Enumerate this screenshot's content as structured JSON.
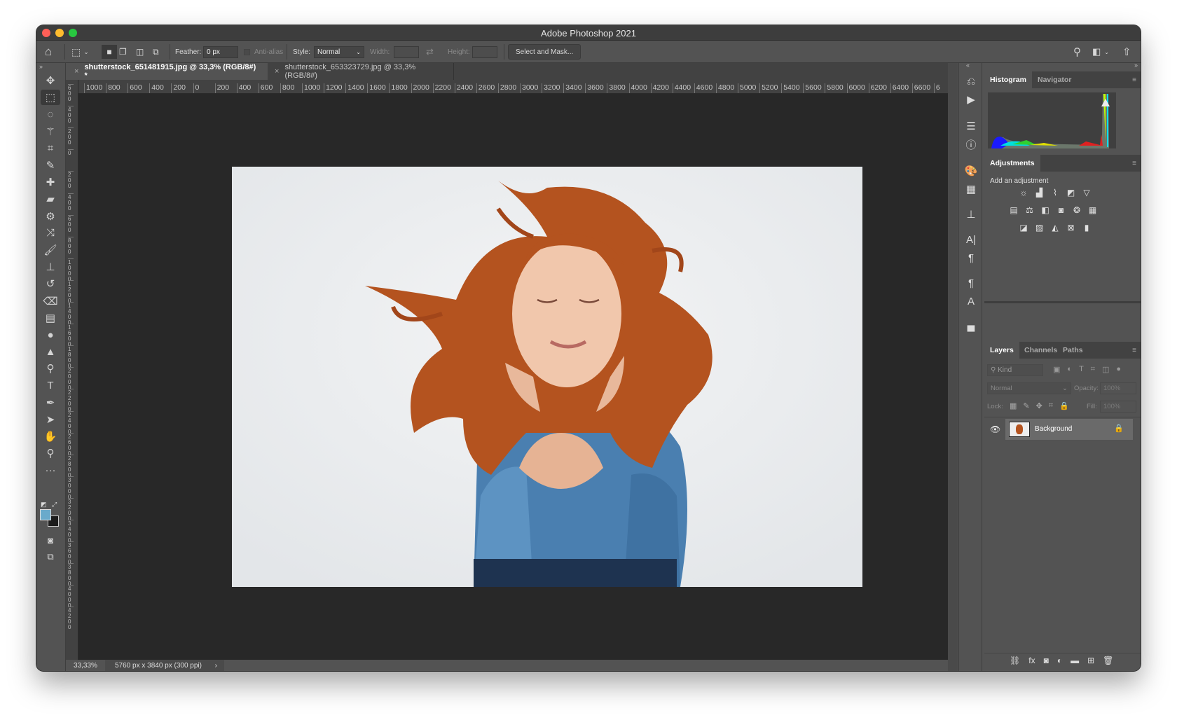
{
  "window": {
    "title": "Adobe Photoshop 2021",
    "traffic_lights": [
      "#fe5f57",
      "#febc2e",
      "#28c840"
    ]
  },
  "options": {
    "feather_label": "Feather:",
    "feather_value": "0 px",
    "antialias_label": "Anti-alias",
    "style_label": "Style:",
    "style_value": "Normal",
    "width_label": "Width:",
    "height_label": "Height:",
    "select_mask": "Select and Mask..."
  },
  "tabs": [
    {
      "label": "shutterstock_651481915.jpg @ 33,3% (RGB/8#) *",
      "active": true
    },
    {
      "label": "shutterstock_653323729.jpg @ 33,3% (RGB/8#)",
      "active": false
    }
  ],
  "hruler": [
    "1000",
    "800",
    "600",
    "400",
    "200",
    "0",
    "200",
    "400",
    "600",
    "800",
    "1000",
    "1200",
    "1400",
    "1600",
    "1800",
    "2000",
    "2200",
    "2400",
    "2600",
    "2800",
    "3000",
    "3200",
    "3400",
    "3600",
    "3800",
    "4000",
    "4200",
    "4400",
    "4600",
    "4800",
    "5000",
    "5200",
    "5400",
    "5600",
    "5800",
    "6000",
    "6200",
    "6400",
    "6600",
    "6"
  ],
  "vruler": [
    "600",
    "400",
    "200",
    "0",
    "200",
    "400",
    "600",
    "800",
    "1000",
    "1200",
    "1400",
    "1600",
    "1800",
    "2000",
    "2200",
    "2400",
    "2600",
    "2800",
    "3000",
    "3200",
    "3400",
    "3600",
    "3800",
    "4000",
    "4200"
  ],
  "tools": [
    {
      "n": "move-tool",
      "g": "✥"
    },
    {
      "n": "rectangular-marquee-tool",
      "g": "⬚"
    },
    {
      "n": "lasso-tool",
      "g": "◌"
    },
    {
      "n": "magic-wand-tool",
      "g": "⚚"
    },
    {
      "n": "crop-tool",
      "g": "⌗"
    },
    {
      "n": "eyedropper-tool",
      "g": "✎"
    },
    {
      "n": "spot-healing-tool",
      "g": "✚"
    },
    {
      "n": "healing-brush-tool",
      "g": "▰"
    },
    {
      "n": "patch-tool",
      "g": "⚙"
    },
    {
      "n": "content-aware-move-tool",
      "g": "⤨"
    },
    {
      "n": "brush-tool",
      "g": "🖌"
    },
    {
      "n": "clone-stamp-tool",
      "g": "⊥"
    },
    {
      "n": "history-brush-tool",
      "g": "↺"
    },
    {
      "n": "eraser-tool",
      "g": "⌫"
    },
    {
      "n": "gradient-tool",
      "g": "▤"
    },
    {
      "n": "blur-tool",
      "g": "●"
    },
    {
      "n": "sharpen-tool",
      "g": "▲"
    },
    {
      "n": "dodge-tool",
      "g": "⚲"
    },
    {
      "n": "type-tool",
      "g": "T"
    },
    {
      "n": "pen-tool",
      "g": "✒"
    },
    {
      "n": "path-selection-tool",
      "g": "➤"
    },
    {
      "n": "hand-tool",
      "g": "✋"
    },
    {
      "n": "zoom-tool",
      "g": "⚲"
    },
    {
      "n": "edit-toolbar",
      "g": "···"
    }
  ],
  "colors": {
    "foreground": "#6aaacb",
    "background": "#1c1c1c",
    "canvas": "#282828",
    "panel": "#535353"
  },
  "status": {
    "zoom": "33,33%",
    "doc_info": "5760 px x 3840 px (300 ppi)"
  },
  "strip": [
    {
      "n": "history-icon",
      "g": "⎌"
    },
    {
      "n": "actions-play-icon",
      "g": "▶"
    },
    {
      "n": "properties-icon",
      "g": "☰"
    },
    {
      "n": "info-icon",
      "g": "ⓘ"
    },
    {
      "n": "swatches-icon",
      "g": "🎨"
    },
    {
      "n": "table-icon",
      "g": "▦"
    },
    {
      "n": "clone-source-icon",
      "g": "⊥"
    },
    {
      "n": "character-icon",
      "g": "A|"
    },
    {
      "n": "paragraph-icon",
      "g": "¶"
    },
    {
      "n": "paragraph-styles-icon",
      "g": "¶"
    },
    {
      "n": "character-styles-icon",
      "g": "A"
    },
    {
      "n": "libraries-icon",
      "g": "▄"
    }
  ],
  "histogram": {
    "tabs": [
      "Histogram",
      "Navigator"
    ]
  },
  "adjustments": {
    "title": "Adjustments",
    "subtitle": "Add an adjustment",
    "rows": [
      [
        {
          "n": "brightness-contrast-icon",
          "g": "☼"
        },
        {
          "n": "levels-icon",
          "g": "▟"
        },
        {
          "n": "curves-icon",
          "g": "⌇"
        },
        {
          "n": "exposure-icon",
          "g": "◩"
        },
        {
          "n": "vibrance-icon",
          "g": "▽"
        }
      ],
      [
        {
          "n": "hue-saturation-icon",
          "g": "▤"
        },
        {
          "n": "color-balance-icon",
          "g": "⚖"
        },
        {
          "n": "black-white-icon",
          "g": "◧"
        },
        {
          "n": "photo-filter-icon",
          "g": "◙"
        },
        {
          "n": "channel-mixer-icon",
          "g": "❂"
        },
        {
          "n": "color-lookup-icon",
          "g": "▦"
        }
      ],
      [
        {
          "n": "invert-icon",
          "g": "◪"
        },
        {
          "n": "posterize-icon",
          "g": "▨"
        },
        {
          "n": "threshold-icon",
          "g": "◭"
        },
        {
          "n": "selective-color-icon",
          "g": "⊠"
        },
        {
          "n": "gradient-map-icon",
          "g": "▮"
        }
      ]
    ]
  },
  "layers": {
    "tabs": [
      "Layers",
      "Channels",
      "Paths"
    ],
    "kind_placeholder": "Kind",
    "blend_mode": "Normal",
    "opacity_label": "Opacity:",
    "opacity_value": "100%",
    "lock_label": "Lock:",
    "fill_label": "Fill:",
    "fill_value": "100%",
    "items": [
      {
        "name": "Background",
        "visible": true,
        "locked": true
      }
    ],
    "footer": [
      {
        "n": "link-layers-icon",
        "g": "⛓"
      },
      {
        "n": "fx-icon",
        "g": "fx"
      },
      {
        "n": "add-mask-icon",
        "g": "◙"
      },
      {
        "n": "adjustment-layer-icon",
        "g": "◐"
      },
      {
        "n": "new-group-icon",
        "g": "▬"
      },
      {
        "n": "new-layer-icon",
        "g": "⊞"
      },
      {
        "n": "delete-layer-icon",
        "g": "🗑"
      }
    ]
  }
}
